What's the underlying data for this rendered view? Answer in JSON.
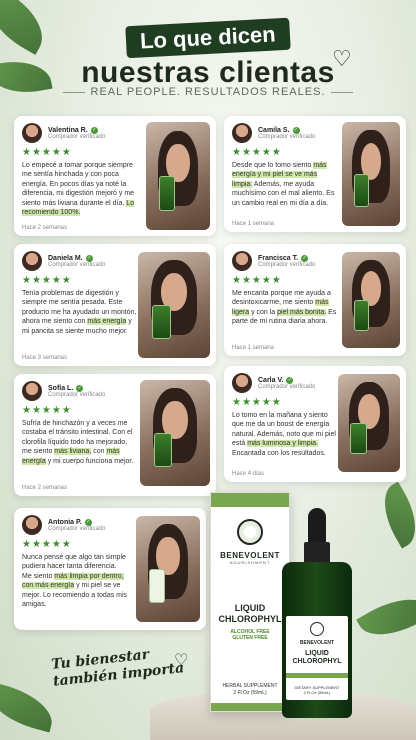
{
  "header": {
    "title_line1": "Lo que dicen",
    "title_line2": "nuestras clientas",
    "heart_icon": "♡",
    "subtitle": "REAL PEOPLE. RESULTADOS REALES."
  },
  "reviews": [
    {
      "name": "Valentina R.",
      "verified": "Comprador verificado",
      "stars": "★★★★★",
      "text_before": "Lo empecé a tomar porque siempre me sentía hinchada y con poca energía. En pocos días ya noté la diferencia, mi digestión mejoró y me siento más liviana durante el día. ",
      "highlight1": "Lo recomiendo 100%.",
      "text_middle": "",
      "highlight2": "",
      "text_after": "",
      "time": "Hace 2 semanas"
    },
    {
      "name": "Camila S.",
      "verified": "Comprador verificado",
      "stars": "★★★★★",
      "text_before": "Desde que lo tomo siento ",
      "highlight1": "más energía y mi piel se ve más limpia.",
      "text_middle": " Además, me ayuda muchísimo con el mal aliento. Es un cambio real en mi día a día.",
      "highlight2": "",
      "text_after": "",
      "time": "Hace 1 semana"
    },
    {
      "name": "Daniela M.",
      "verified": "Comprador verificado",
      "stars": "★★★★★",
      "text_before": "Tenía problemas de digestión y siempre me sentía pesada. Este producto me ha ayudado un montón, ahora me siento con ",
      "highlight1": "más energía",
      "text_middle": " y mi pancita se siente mucho mejor.",
      "highlight2": "",
      "text_after": "",
      "time": "Hace 3 semanas"
    },
    {
      "name": "Francisca T.",
      "verified": "Comprador verificado",
      "stars": "★★★★★",
      "text_before": "Me encanta porque me ayuda a desintoxicarme, me siento ",
      "highlight1": "más ligera",
      "text_middle": " y con la ",
      "highlight2": "piel más bonita.",
      "text_after": " Es parte de mi rutina diaria ahora.",
      "time": "Hace 1 semana"
    },
    {
      "name": "Sofía L.",
      "verified": "Comprador verificado",
      "stars": "★★★★★",
      "text_before": "Sufría de hinchazón y a veces me costaba el tránsito intestinal. Con el clorofila líquido todo ha mejorado, me siento ",
      "highlight1": "más liviana,",
      "text_middle": " con ",
      "highlight2": "más energía",
      "text_after": " y mi cuerpo funciona mejor.",
      "time": "Hace 2 semanas"
    },
    {
      "name": "Carla V.",
      "verified": "Comprador verificado",
      "stars": "★★★★★",
      "text_before": "Lo tomo en la mañana y siento que me da un boost de energía natural. Además, noto que mi piel está ",
      "highlight1": "más luminosa y limpia.",
      "text_middle": " Encantada con los resultados.",
      "highlight2": "",
      "text_after": "",
      "time": "Hace 4 días"
    },
    {
      "name": "Antonia P.",
      "verified": "Comprador verificado",
      "stars": "★★★★★",
      "text_before": "Nunca pensé que algo tan simple pudiera hacer tanta diferencia. Me siento ",
      "highlight1": "más limpia por dentro,",
      "text_middle": " ",
      "highlight2": "con más energía",
      "text_after": " y mi piel se ve mejor. Lo recomiendo a todas mis amigas.",
      "time": ""
    }
  ],
  "product": {
    "box_brand": "BENEVOLENT",
    "box_brand_sub": "NOURISHMENT",
    "box_title_1": "LIQUID",
    "box_title_2": "CHLOROPHYL",
    "box_free_1": "ALCOHOL FREE",
    "box_free_2": "GLUTEN FREE",
    "box_foot_1": "HERBAL SUPPLEMENT",
    "box_foot_2": "2 Fl.Oz (59mL)",
    "bottle_brand": "BENEVOLENT",
    "bottle_title_1": "LIQUID",
    "bottle_title_2": "CHLOROPHYL",
    "bottle_foot_1": "DIETARY SUPPLEMENT",
    "bottle_foot_2": "2 Fl.Oz (59mL)"
  },
  "footer": {
    "tagline_1": "Tu bienestar",
    "tagline_2": "también importa",
    "heart_icon": "♡"
  },
  "colors": {
    "accent": "#1f3d21",
    "highlight": "#cfe8a8",
    "star": "#3f8e2d"
  }
}
